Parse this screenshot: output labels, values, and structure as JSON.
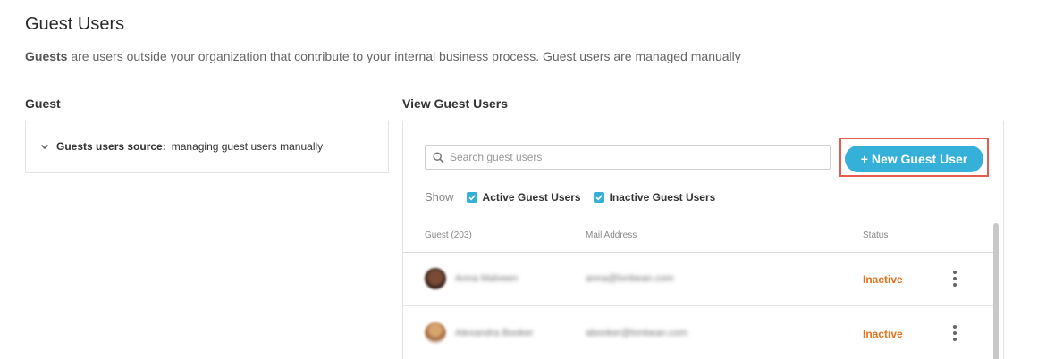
{
  "page": {
    "title": "Guest Users",
    "description_bold": "Guests",
    "description_rest": " are users outside your organization that contribute to your internal business process. Guest users are managed manually"
  },
  "guest_section": {
    "title": "Guest",
    "source_label": "Guests users source:",
    "source_value": "managing guest users manually"
  },
  "view_section": {
    "title": "View Guest Users",
    "search_placeholder": "Search guest users",
    "new_button": "+ New Guest User",
    "show_label": "Show",
    "filters": [
      {
        "label": "Active Guest Users",
        "checked": true
      },
      {
        "label": "Inactive Guest Users",
        "checked": true
      }
    ],
    "columns": {
      "guest": "Guest (203)",
      "mail": "Mail Address",
      "status": "Status"
    },
    "rows": [
      {
        "name": "Anna Malveen",
        "email": "anna@lonbean.com",
        "status": "Inactive"
      },
      {
        "name": "Alexandra Booker",
        "email": "abooker@lonbean.com",
        "status": "Inactive"
      }
    ]
  },
  "colors": {
    "accent": "#35b1d9",
    "highlight_border": "#e35d4f",
    "inactive_status": "#e8711a"
  }
}
